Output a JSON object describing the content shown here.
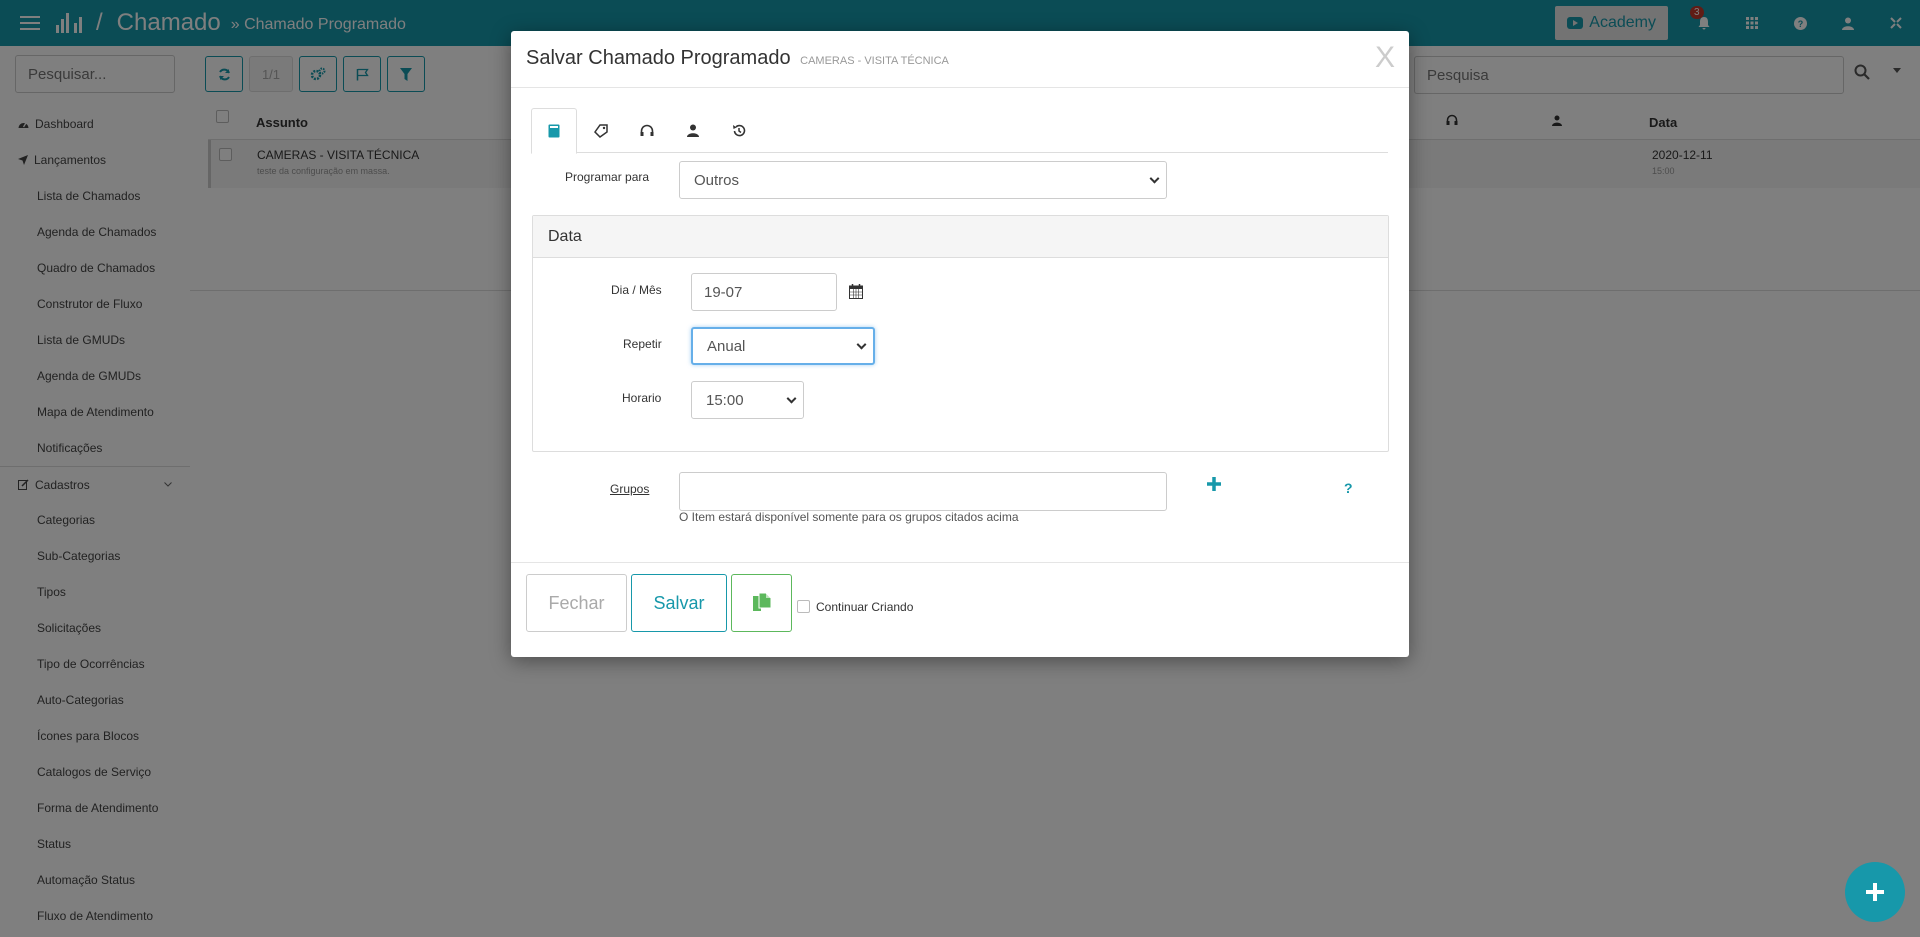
{
  "topbar": {
    "title": "Chamado",
    "crumb": "» Chamado Programado",
    "academy_label": "Academy",
    "notif_count": "3"
  },
  "sidebar": {
    "search_placeholder": "Pesquisar...",
    "items": [
      {
        "label": "Dashboard"
      },
      {
        "label": "Lançamentos"
      },
      {
        "label": "Lista de Chamados"
      },
      {
        "label": "Agenda de Chamados"
      },
      {
        "label": "Quadro de Chamados"
      },
      {
        "label": "Construtor de Fluxo"
      },
      {
        "label": "Lista de GMUDs"
      },
      {
        "label": "Agenda de GMUDs"
      },
      {
        "label": "Mapa de Atendimento"
      },
      {
        "label": "Notificações"
      },
      {
        "label": "Cadastros"
      },
      {
        "label": "Categorias"
      },
      {
        "label": "Sub-Categorias"
      },
      {
        "label": "Tipos"
      },
      {
        "label": "Solicitações"
      },
      {
        "label": "Tipo de Ocorrências"
      },
      {
        "label": "Auto-Categorias"
      },
      {
        "label": "Ícones para Blocos"
      },
      {
        "label": "Catalogos de Serviço"
      },
      {
        "label": "Forma de Atendimento"
      },
      {
        "label": "Status"
      },
      {
        "label": "Automação Status"
      },
      {
        "label": "Fluxo de Atendimento"
      }
    ]
  },
  "main": {
    "pager": "1/1",
    "search_placeholder": "Pesquisa",
    "columns": {
      "subject": "Assunto",
      "date": "Data"
    },
    "rows": [
      {
        "subject": "CAMERAS - VISITA TÉCNICA",
        "note": "teste da configuração em massa.",
        "date": "2020-12-11",
        "time": "15:00"
      }
    ]
  },
  "modal": {
    "title": "Salvar Chamado Programado",
    "subtitle": "CAMERAS - VISITA TÉCNICA",
    "close": "X",
    "program_label": "Programar para",
    "program_value": "Outros",
    "panel_title": "Data",
    "day_label": "Dia / Mês",
    "day_value": "19-07",
    "repeat_label": "Repetir",
    "repeat_value": "Anual",
    "time_label": "Horario",
    "time_value": "15:00",
    "groups_label": "Grupos",
    "groups_help": "O Item estará disponível somente para os grupos citados acima",
    "close_button": "Fechar",
    "save_button": "Salvar",
    "continue_label": "Continuar Criando"
  },
  "colors": {
    "accent": "#1798aa",
    "copy_green": "#5cb85c",
    "badge_red": "#c0392b"
  }
}
